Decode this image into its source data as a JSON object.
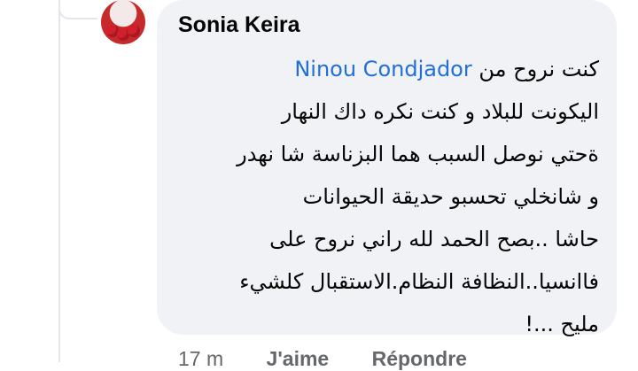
{
  "comment": {
    "author": "Sonia Keira",
    "mention": "Ninou Condjador",
    "lines": [
      "كنت نروح من",
      "اليكونت للبلاد و كنت نكره داك النهار",
      "ةحتي نوصل السبب هما البزناسة شا نهدر",
      "و شانخلي تحسبو حديقة الحيوانات",
      "حاشا ..بصح الحمد لله راني نروح على",
      "فاانسيا..النظافة النظام.الاستقبال كلشيء",
      "مليح ...!"
    ]
  },
  "actions": {
    "time": "17 m",
    "like": "J'aime",
    "reply": "Répondre"
  }
}
